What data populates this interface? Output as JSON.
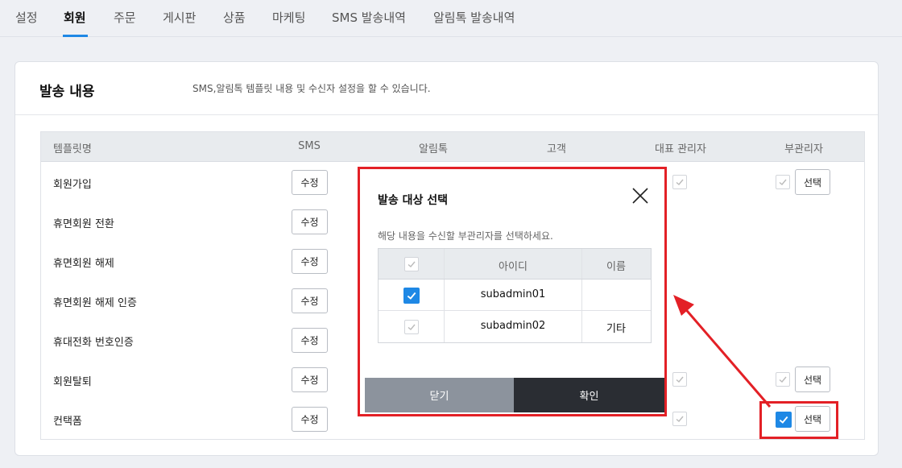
{
  "tabs": [
    "설정",
    "회원",
    "주문",
    "게시판",
    "상품",
    "마케팅",
    "SMS 발송내역",
    "알림톡 발송내역"
  ],
  "active_tab": "회원",
  "panel": {
    "title": "발송 내용",
    "description": "SMS,알림톡 템플릿 내용 및 수신자 설정을 할 수 있습니다."
  },
  "table": {
    "headers": [
      "템플릿명",
      "SMS",
      "알림톡",
      "고객",
      "대표 관리자",
      "부관리자"
    ],
    "edit_label": "수정",
    "select_label": "선택",
    "rows": [
      {
        "name": "회원가입"
      },
      {
        "name": "휴면회원 전환"
      },
      {
        "name": "휴면회원 해제"
      },
      {
        "name": "휴면회원 해제 인증"
      },
      {
        "name": "휴대전화 번호인증"
      },
      {
        "name": "회원탈퇴"
      },
      {
        "name": "컨택폼"
      }
    ]
  },
  "modal": {
    "title": "발송 대상 선택",
    "description": "해당 내용을 수신할 부관리자를 선택하세요.",
    "headers": [
      "아이디",
      "이름"
    ],
    "rows": [
      {
        "id": "subadmin01",
        "name": "",
        "checked": true
      },
      {
        "id": "subadmin02",
        "name": "기타",
        "checked": false
      }
    ],
    "close_label": "닫기",
    "confirm_label": "확인"
  },
  "colors": {
    "accent": "#1e88e5",
    "highlight": "#e32026",
    "dark_button": "#2a2d33",
    "gray_button": "#8c939d"
  },
  "icons": {
    "check": "check-icon",
    "close": "close-icon"
  }
}
